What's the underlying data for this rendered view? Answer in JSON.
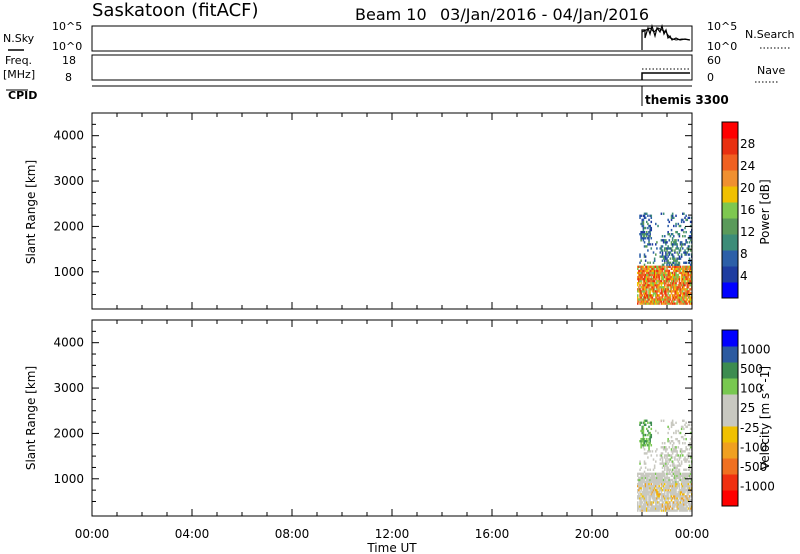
{
  "header": {
    "station": "Saskatoon (fitACF)",
    "beam": "Beam 10",
    "date_range": "03/Jan/2016 - 04/Jan/2016"
  },
  "panels": {
    "noise": {
      "left_label": "N.Sky",
      "right_label": "N.Search",
      "left_ticks": [
        "10^5",
        "10^0"
      ],
      "right_ticks": [
        "10^5",
        "10^0"
      ]
    },
    "freq": {
      "left_label_1": "Freq.",
      "left_label_2": "[MHz]",
      "right_label": "Nave",
      "left_ticks": [
        "18",
        "8"
      ],
      "right_ticks": [
        "60",
        "0"
      ]
    },
    "cpid": {
      "label": "CPID",
      "program": "themis 3300"
    }
  },
  "colors": {
    "power_scale": [
      "#0000ff",
      "#1e3ca0",
      "#2c5fa8",
      "#3c8c78",
      "#5a9a5a",
      "#7ec850",
      "#f0c000",
      "#f09030",
      "#f06020",
      "#e83010",
      "#ff0000"
    ],
    "velocity_scale": [
      "#ff0000",
      "#f03010",
      "#f07020",
      "#f0a020",
      "#f0c000",
      "#c8c8c0",
      "#c8c8c0",
      "#78c850",
      "#3c8c50",
      "#2c5aa0",
      "#0000ff"
    ]
  },
  "chart_data": [
    {
      "type": "heatmap",
      "name": "power",
      "ylabel": "Slant Range [km]",
      "colorbar_label": "Power [dB]",
      "colorbar_ticks": [
        "28",
        "24",
        "20",
        "16",
        "12",
        "8",
        "4"
      ],
      "ylim": [
        180,
        4500
      ],
      "yticks": [
        "4000",
        "3000",
        "2000",
        "1000"
      ],
      "xlim": [
        0,
        24
      ],
      "xticks": [
        "00:00",
        "04:00",
        "08:00",
        "12:00",
        "16:00",
        "20:00",
        "00:00"
      ],
      "data_start_hour": 21.8,
      "description_region": "echoes 21.8-24 UT, 300-2300 km"
    },
    {
      "type": "heatmap",
      "name": "velocity",
      "ylabel": "Slant Range [km]",
      "colorbar_label": "Velocity [m s^-1]",
      "colorbar_ticks": [
        "1000",
        "500",
        "100",
        "25",
        "-25",
        "-100",
        "-500",
        "-1000"
      ],
      "ylim": [
        180,
        4500
      ],
      "yticks": [
        "4000",
        "3000",
        "2000",
        "1000"
      ],
      "xlim": [
        0,
        24
      ],
      "xticks": [
        "00:00",
        "04:00",
        "08:00",
        "12:00",
        "16:00",
        "20:00",
        "00:00"
      ],
      "xlabel": "Time UT"
    }
  ]
}
